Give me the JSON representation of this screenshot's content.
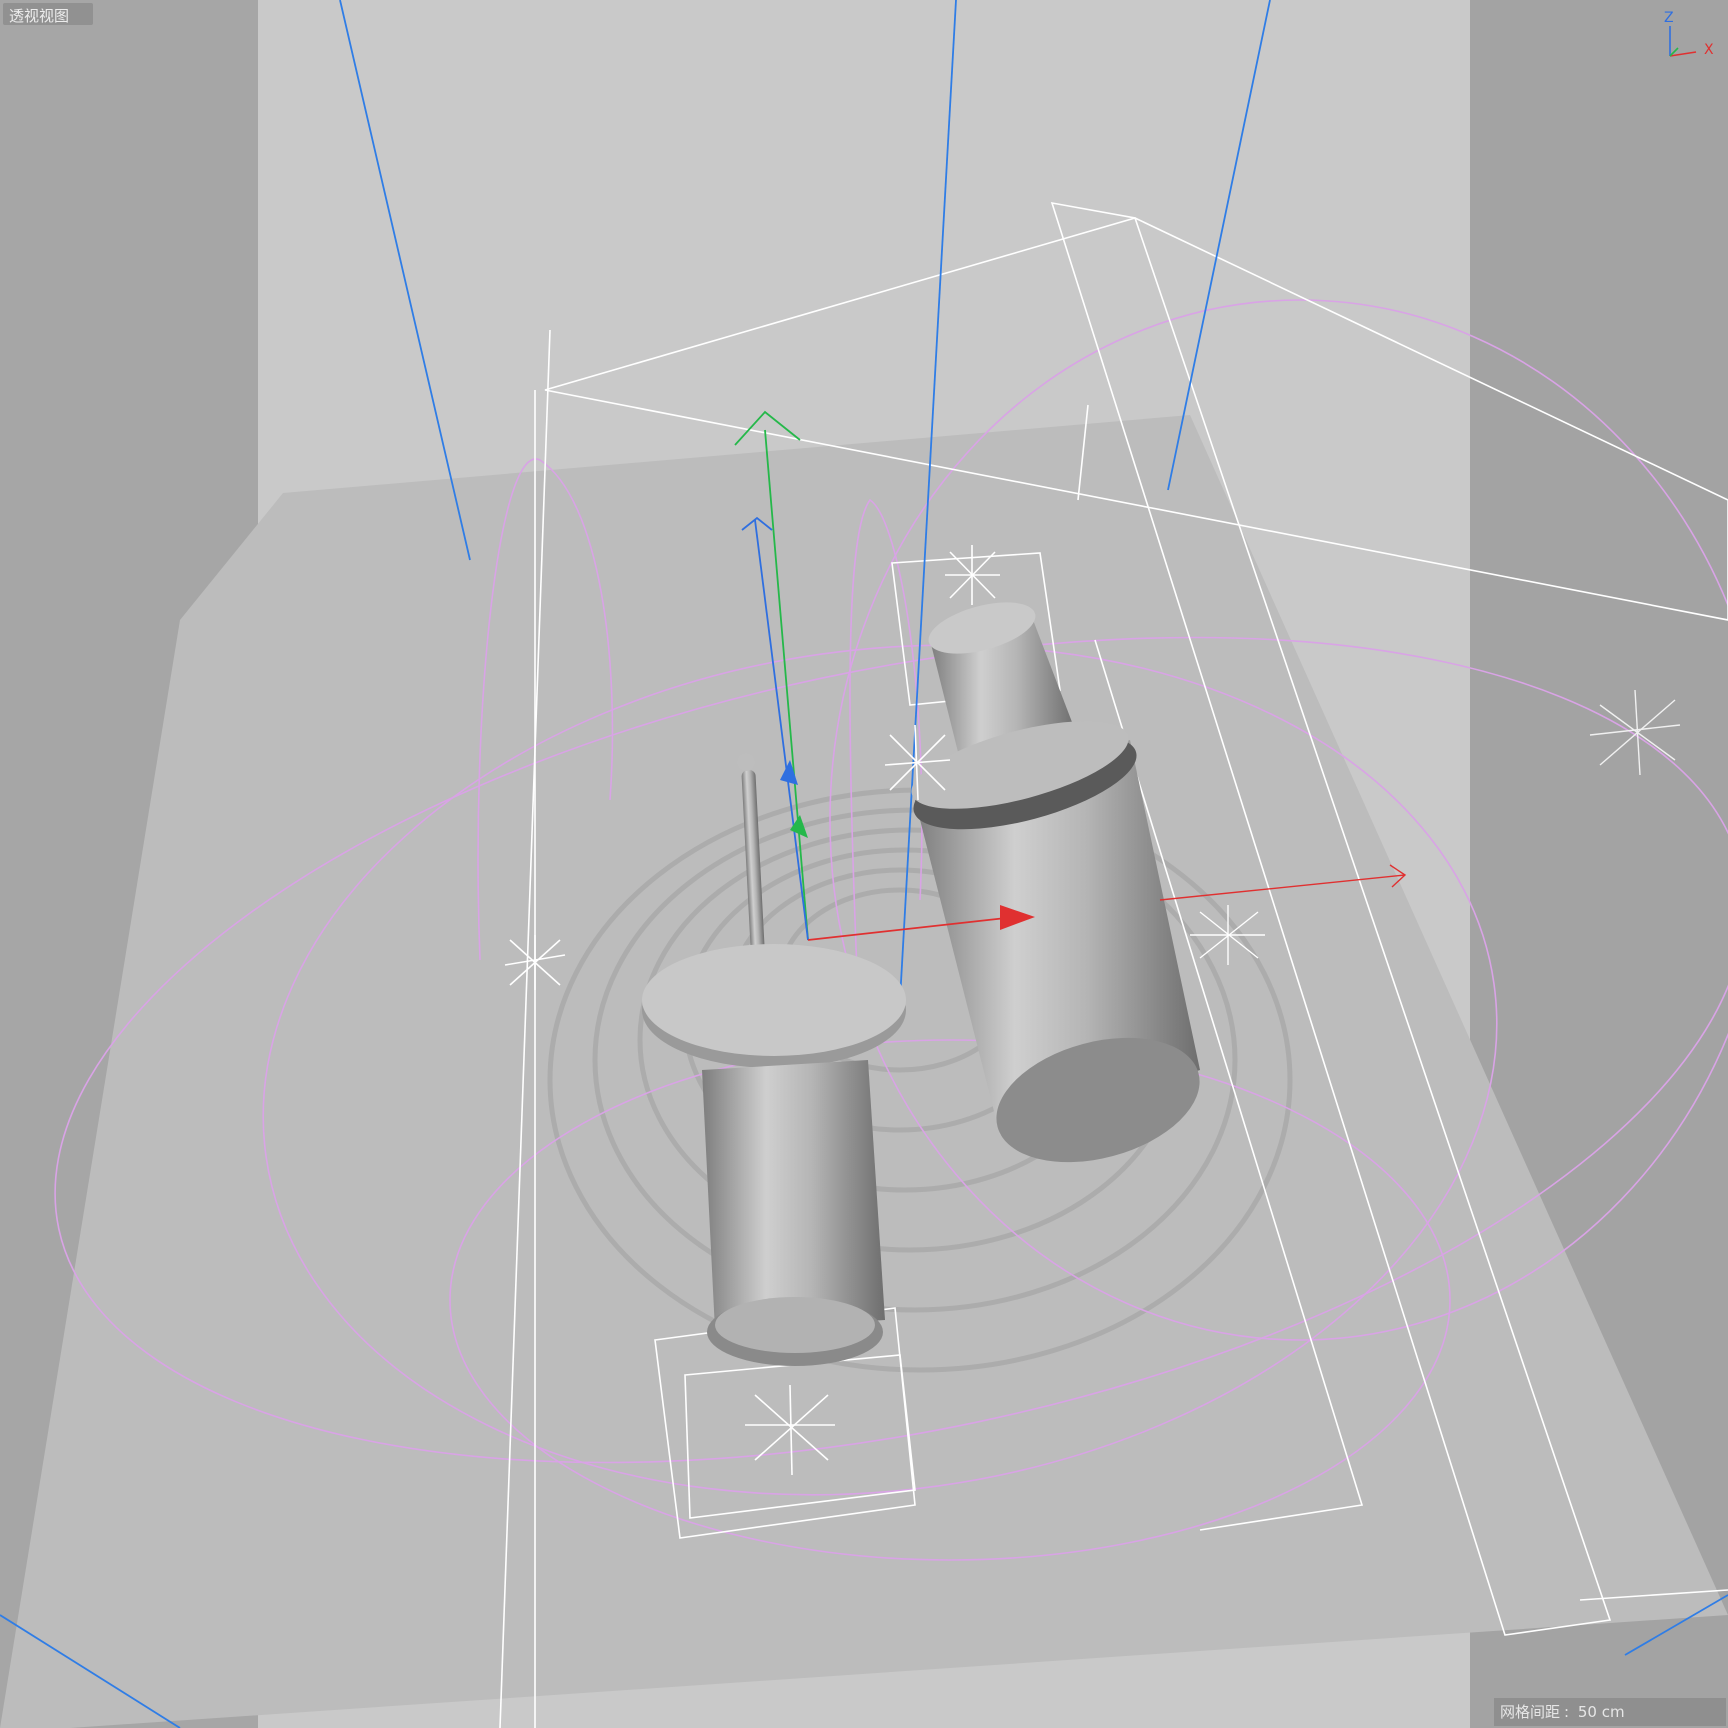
{
  "viewport": {
    "view_name": "透视视图",
    "grid_spacing_label": "网格间距",
    "grid_spacing_value": "50 cm",
    "axes": {
      "z": "Z",
      "x": "X"
    }
  },
  "colors": {
    "background_side": "#a6a6a6",
    "background_center": "#c8c8c8",
    "floor": "#bebebe",
    "wireframe_white": "#ffffff",
    "spline_pink": "#d9a3e6",
    "camera_blue": "#2f7de6",
    "axis_red": "#e03030",
    "axis_green": "#25b84a",
    "axis_blue": "#2f6fe0"
  },
  "icons": [
    "light-star-icon",
    "axis-gizmo-icon",
    "null-object-icon"
  ]
}
